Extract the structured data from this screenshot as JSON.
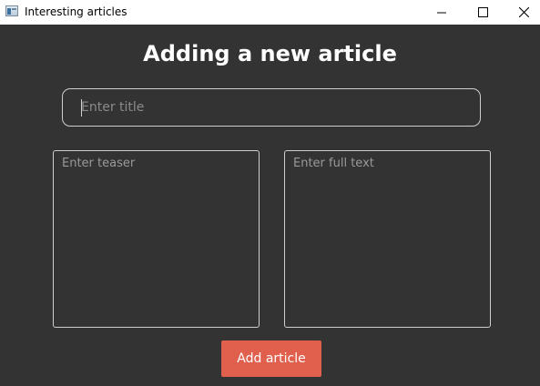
{
  "window": {
    "title": "Interesting articles",
    "icon": "app-window-icon",
    "controls": {
      "minimize_icon": "minimize-icon",
      "maximize_icon": "maximize-icon",
      "close_icon": "close-icon"
    }
  },
  "form": {
    "heading": "Adding a new article",
    "title_placeholder": "Enter title",
    "title_value": "",
    "teaser_placeholder": "Enter teaser",
    "teaser_value": "",
    "fulltext_placeholder": "Enter full text",
    "fulltext_value": "",
    "submit_label": "Add article"
  },
  "colors": {
    "background": "#333333",
    "accent": "#e0604d",
    "heading": "#ffffff",
    "field_border": "#cfcfcf",
    "placeholder": "#8a8a8a"
  }
}
